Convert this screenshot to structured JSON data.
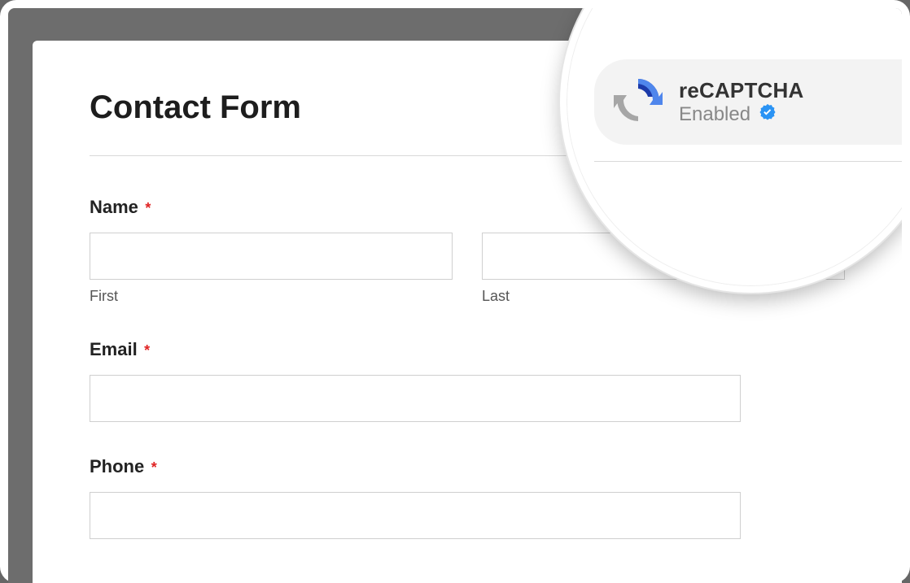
{
  "form": {
    "title": "Contact Form",
    "fields": {
      "name": {
        "label": "Name",
        "required_mark": "*",
        "first_value": "",
        "first_sublabel": "First",
        "last_value": "",
        "last_sublabel": "Last"
      },
      "email": {
        "label": "Email",
        "required_mark": "*",
        "value": ""
      },
      "phone": {
        "label": "Phone",
        "required_mark": "*",
        "value": ""
      }
    }
  },
  "captcha": {
    "title": "reCAPTCHA",
    "status": "Enabled",
    "verified": true,
    "colors": {
      "dark_blue": "#1c3aa9",
      "blue": "#4f86ec",
      "gray": "#a6a6a6",
      "badge": "#2a93f4"
    }
  }
}
